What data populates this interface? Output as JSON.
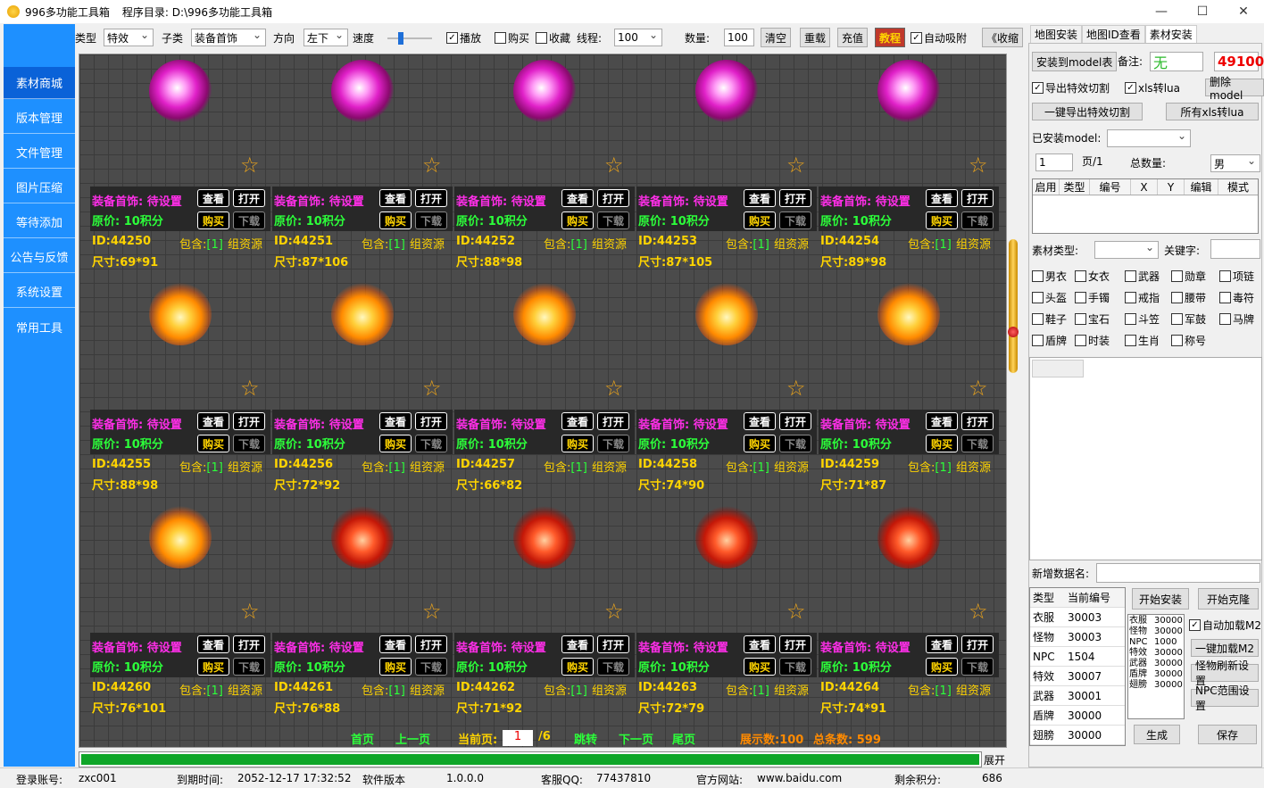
{
  "window": {
    "app_title": "996多功能工具箱",
    "dir_label": "程序目录:",
    "dir_value": "D:\\996多功能工具箱",
    "minimize": "—",
    "maximize": "☐",
    "close": "✕"
  },
  "sidebar": {
    "items": [
      "素材商城",
      "版本管理",
      "文件管理",
      "图片压缩",
      "等待添加",
      "公告与反馈",
      "系统设置",
      "常用工具"
    ]
  },
  "toolbar": {
    "type_label": "类型",
    "type_value": "特效",
    "subtype_label": "子类",
    "subtype_value": "装备首饰",
    "direction_label": "方向",
    "direction_value": "左下",
    "speed_label": "速度",
    "play_label": "播放",
    "play_checked": true,
    "buy_label": "购买",
    "buy_checked": false,
    "fav_label": "收藏",
    "fav_checked": false,
    "thread_label": "线程:",
    "thread_value": "100",
    "count_label": "数量:",
    "count_value": "100",
    "clear": "清空",
    "reload": "重载",
    "recharge": "充值",
    "tutorial": "教程",
    "auto_attach_label": "自动吸附",
    "auto_attach_checked": true,
    "collapse": "《收缩"
  },
  "card_labels": {
    "title": "装备首饰: 待设置",
    "price": "原价: 10积分",
    "view": "查看",
    "open": "打开",
    "buy": "购买",
    "download": "下载",
    "contains": "包含:",
    "contains_count": "[1]",
    "group": "组资源"
  },
  "cards": [
    {
      "id": "ID:44250",
      "size": "尺寸:69*91",
      "art": "orb"
    },
    {
      "id": "ID:44251",
      "size": "尺寸:87*106",
      "art": "orb"
    },
    {
      "id": "ID:44252",
      "size": "尺寸:88*98",
      "art": "orb"
    },
    {
      "id": "ID:44253",
      "size": "尺寸:87*105",
      "art": "orb"
    },
    {
      "id": "ID:44254",
      "size": "尺寸:89*98",
      "art": "orb"
    },
    {
      "id": "ID:44255",
      "size": "尺寸:88*98",
      "art": "gold"
    },
    {
      "id": "ID:44256",
      "size": "尺寸:72*92",
      "art": "gold"
    },
    {
      "id": "ID:44257",
      "size": "尺寸:66*82",
      "art": "gold"
    },
    {
      "id": "ID:44258",
      "size": "尺寸:74*90",
      "art": "gold"
    },
    {
      "id": "ID:44259",
      "size": "尺寸:71*87",
      "art": "gold"
    },
    {
      "id": "ID:44260",
      "size": "尺寸:76*101",
      "art": "gold"
    },
    {
      "id": "ID:44261",
      "size": "尺寸:76*88",
      "art": "red"
    },
    {
      "id": "ID:44262",
      "size": "尺寸:71*92",
      "art": "red"
    },
    {
      "id": "ID:44263",
      "size": "尺寸:72*79",
      "art": "red"
    },
    {
      "id": "ID:44264",
      "size": "尺寸:74*91",
      "art": "red"
    }
  ],
  "pager": {
    "first": "首页",
    "prev": "上一页",
    "current_label": "当前页:",
    "current_value": "1",
    "total_pages": "/6",
    "jump": "跳转",
    "next": "下一页",
    "last": "尾页",
    "shown": "展示数:100",
    "total": "总条数: 599"
  },
  "progress": {
    "percent": 100,
    "expand": "展开"
  },
  "status": {
    "account_label": "登录账号:",
    "account_value": "zxc001",
    "expire_label": "到期时间:",
    "expire_value": "2052-12-17 17:32:52",
    "version_label": "软件版本",
    "version_value": "1.0.0.0",
    "qq_label": "客服QQ:",
    "qq_value": "77437810",
    "site_label": "官方网站:",
    "site_value": "www.baidu.com",
    "points_label": "剩余积分:",
    "points_value": "686"
  },
  "right": {
    "tabs": [
      "地图安装",
      "地图ID查看",
      "素材安装"
    ],
    "install_model_table": "安装到model表",
    "remark_label": "备注:",
    "remark_value": "无",
    "points": "49100",
    "export_cut_label": "导出特效切割",
    "export_cut_checked": true,
    "xls_lua_label": "xls转lua",
    "xls_lua_checked": true,
    "delete_model": "删除model",
    "one_click_export": "一键导出特效切割",
    "all_xls_lua": "所有xls转lua",
    "installed_model_label": "已安装model:",
    "installed_model_value": "",
    "page_value": "1",
    "page_label": "页/1",
    "total_label": "总数量:",
    "gender_value": "男",
    "table_headers": [
      "启用",
      "类型",
      "编号",
      "X",
      "Y",
      "编辑",
      "模式"
    ],
    "material_type_label": "素材类型:",
    "material_type_value": "",
    "keyword_label": "关键字:",
    "keyword_value": "",
    "categories": [
      "男衣",
      "女衣",
      "武器",
      "勋章",
      "项链",
      "头盔",
      "手镯",
      "戒指",
      "腰带",
      "毒符",
      "鞋子",
      "宝石",
      "斗笠",
      "军鼓",
      "马牌",
      "盾牌",
      "时装",
      "生肖",
      "称号"
    ],
    "new_data_label": "新增数据名:",
    "new_data_value": "",
    "type_table_headers": [
      "类型",
      "当前编号"
    ],
    "type_table": [
      [
        "衣服",
        "30003"
      ],
      [
        "怪物",
        "30003"
      ],
      [
        "NPC",
        "1504"
      ],
      [
        "特效",
        "30007"
      ],
      [
        "武器",
        "30001"
      ],
      [
        "盾牌",
        "30000"
      ],
      [
        "翅膀",
        "30000"
      ]
    ],
    "mini_table": [
      [
        "衣服",
        "30000"
      ],
      [
        "怪物",
        "30000"
      ],
      [
        "NPC",
        "1000"
      ],
      [
        "特效",
        "30000"
      ],
      [
        "武器",
        "30000"
      ],
      [
        "盾牌",
        "30000"
      ],
      [
        "翅膀",
        "30000"
      ]
    ],
    "start_install": "开始安装",
    "start_clone": "开始克隆",
    "auto_load_label": "自动加载M2",
    "auto_load_checked": true,
    "one_click_load": "一键加载M2",
    "monster_refresh": "怪物刷新设置",
    "npc_range": "NPC范围设置",
    "generate": "生成",
    "save": "保存"
  }
}
